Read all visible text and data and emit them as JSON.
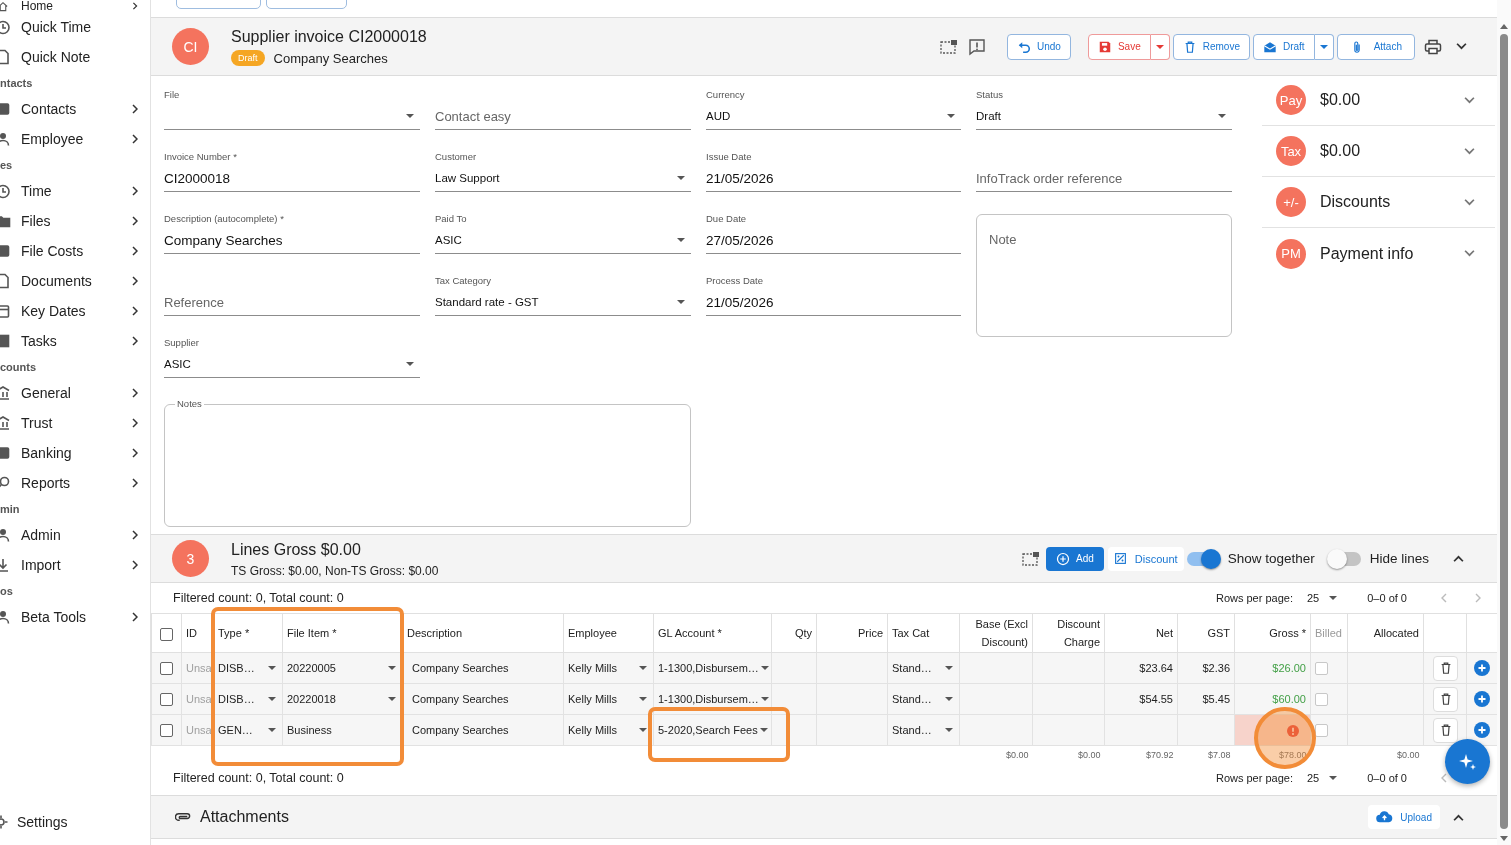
{
  "sidebar": {
    "items": [
      {
        "kind": "item",
        "label": "Home",
        "has_submenu": true
      },
      {
        "kind": "item",
        "label": "Quick Time",
        "has_submenu": false
      },
      {
        "kind": "item",
        "label": "Quick Note",
        "has_submenu": false
      },
      {
        "kind": "section",
        "label": "ntacts"
      },
      {
        "kind": "item",
        "label": "Contacts",
        "has_submenu": true
      },
      {
        "kind": "item",
        "label": "Employee",
        "has_submenu": true
      },
      {
        "kind": "section",
        "label": "es"
      },
      {
        "kind": "item",
        "label": "Time",
        "has_submenu": true
      },
      {
        "kind": "item",
        "label": "Files",
        "has_submenu": true
      },
      {
        "kind": "item",
        "label": "File Costs",
        "has_submenu": true
      },
      {
        "kind": "item",
        "label": "Documents",
        "has_submenu": true
      },
      {
        "kind": "item",
        "label": "Key Dates",
        "has_submenu": true
      },
      {
        "kind": "item",
        "label": "Tasks",
        "has_submenu": true
      },
      {
        "kind": "section",
        "label": "counts"
      },
      {
        "kind": "item",
        "label": "General",
        "has_submenu": true
      },
      {
        "kind": "item",
        "label": "Trust",
        "has_submenu": true
      },
      {
        "kind": "item",
        "label": "Banking",
        "has_submenu": true
      },
      {
        "kind": "item",
        "label": "Reports",
        "has_submenu": true
      },
      {
        "kind": "section",
        "label": "min"
      },
      {
        "kind": "item",
        "label": "Admin",
        "has_submenu": true
      },
      {
        "kind": "item",
        "label": "Import",
        "has_submenu": true
      },
      {
        "kind": "section",
        "label": "os"
      },
      {
        "kind": "item",
        "label": "Beta Tools",
        "has_submenu": true
      }
    ],
    "footer_item": {
      "label": "Settings"
    }
  },
  "header": {
    "avatar": "CI",
    "title": "Supplier invoice CI2000018",
    "status_badge": "Draft",
    "subtitle": "Company Searches",
    "actions": [
      {
        "kind": "undo",
        "label": "Undo",
        "split": false
      },
      {
        "kind": "save",
        "label": "Save",
        "split": true
      },
      {
        "kind": "remove",
        "label": "Remove",
        "split": false
      },
      {
        "kind": "draft",
        "label": "Draft",
        "split": true
      },
      {
        "kind": "attach",
        "label": "Attach",
        "split": false
      }
    ]
  },
  "form": {
    "columns": [
      [
        {
          "kind": "select",
          "label": "File"
        },
        {
          "kind": "text",
          "label": "Invoice Number *",
          "value": "CI2000018"
        },
        {
          "kind": "text",
          "label": "Description (autocomplete) *",
          "value": "Company Searches"
        },
        {
          "kind": "text",
          "placeholder": "Reference"
        },
        {
          "kind": "select",
          "label": "Supplier",
          "value": "ASIC"
        }
      ],
      [
        {
          "kind": "text",
          "placeholder": "Contact easy"
        },
        {
          "kind": "select",
          "label": "Customer",
          "value": "Law Support"
        },
        {
          "kind": "select",
          "label": "Paid To",
          "value": "ASIC"
        },
        {
          "kind": "select",
          "label": "Tax Category",
          "value": "Standard rate - GST"
        }
      ],
      [
        {
          "kind": "select",
          "label": "Currency",
          "value": "AUD"
        },
        {
          "kind": "text",
          "label": "Issue Date",
          "value": "21/05/2026"
        },
        {
          "kind": "text",
          "label": "Due Date",
          "value": "27/05/2026"
        },
        {
          "kind": "text",
          "label": "Process Date",
          "value": "21/05/2026"
        }
      ],
      [
        {
          "kind": "select",
          "label": "Status",
          "value": "Draft"
        },
        {
          "kind": "text",
          "placeholder": "InfoTrack order reference"
        },
        {
          "kind": "textarea",
          "placeholder": "Note"
        }
      ]
    ],
    "notes": {
      "label": "Notes"
    }
  },
  "summary": [
    {
      "badge": "Pay",
      "label": "$0.00",
      "expanded": false
    },
    {
      "badge": "Tax",
      "label": "$0.00",
      "expanded": false
    },
    {
      "badge": "+/-",
      "label": "Discounts",
      "expanded": false
    },
    {
      "badge": "PM",
      "label": "Payment info",
      "expanded": false
    }
  ],
  "lines": {
    "badge": "3",
    "title": "Lines Gross $0.00",
    "subtitle": "TS Gross: $0.00, Non-TS Gross: $0.00",
    "add_label": "Add",
    "discount_label": "Discount",
    "toggles": [
      {
        "label": "Show together",
        "on": true
      },
      {
        "label": "Hide lines",
        "on": false
      }
    ],
    "expanded": true,
    "top_pager": {
      "count": "Filtered count: 0, Total count: 0",
      "rows_per_page_label": "Rows per page:",
      "rows_per_page": "25",
      "range": "0–0 of 0",
      "prev_enabled": false,
      "next_enabled": false
    },
    "table": {
      "columns": [
        {
          "kind": "checkbox",
          "checked": false
        },
        {
          "kind": "text",
          "label": "ID"
        },
        {
          "kind": "text",
          "label": "Type *",
          "highlighted": true
        },
        {
          "kind": "text",
          "label": "File Item *",
          "highlighted": true
        },
        {
          "kind": "text",
          "label": "Description"
        },
        {
          "kind": "text",
          "label": "Employee"
        },
        {
          "kind": "text",
          "label": "GL Account *"
        },
        {
          "kind": "number",
          "label": "Qty"
        },
        {
          "kind": "number",
          "label": "Price"
        },
        {
          "kind": "text",
          "label": "Tax Cat"
        },
        {
          "kind": "number",
          "label": "Base (Excl Discount)"
        },
        {
          "kind": "number",
          "label": "Discount Charge"
        },
        {
          "kind": "number",
          "label": "Net"
        },
        {
          "kind": "number",
          "label": "GST"
        },
        {
          "kind": "number",
          "label": "Gross *"
        },
        {
          "kind": "text",
          "label": "Billed",
          "disabled": true
        },
        {
          "kind": "number",
          "label": "Allocated"
        },
        {
          "kind": "actions"
        },
        {
          "kind": "actions"
        }
      ],
      "rows": [
        {
          "cells": [
            {
              "kind": "checkbox",
              "checked": false
            },
            {
              "kind": "text",
              "text": "Unsa",
              "muted": true
            },
            {
              "kind": "select",
              "text": "DISB…"
            },
            {
              "kind": "select",
              "text": "20220005"
            },
            {
              "kind": "text",
              "text": "Company Searches"
            },
            {
              "kind": "select",
              "text": "Kelly Mills"
            },
            {
              "kind": "select",
              "text": "1-1300,Disbursem…"
            },
            {
              "kind": "empty"
            },
            {
              "kind": "empty"
            },
            {
              "kind": "select",
              "text": "Stand…"
            },
            {
              "kind": "empty"
            },
            {
              "kind": "empty"
            },
            {
              "kind": "number",
              "text": "$23.64"
            },
            {
              "kind": "number",
              "text": "$2.36"
            },
            {
              "kind": "number",
              "text": "$26.00",
              "color": "#43a047"
            },
            {
              "kind": "checkbox",
              "checked": false,
              "disabled": true
            },
            {
              "kind": "empty"
            },
            {
              "kind": "delete"
            },
            {
              "kind": "add"
            }
          ]
        },
        {
          "cells": [
            {
              "kind": "checkbox",
              "checked": false
            },
            {
              "kind": "text",
              "text": "Unsa",
              "muted": true
            },
            {
              "kind": "select",
              "text": "DISB…"
            },
            {
              "kind": "select",
              "text": "20220018"
            },
            {
              "kind": "text",
              "text": "Company Searches"
            },
            {
              "kind": "select",
              "text": "Kelly Mills"
            },
            {
              "kind": "select",
              "text": "1-1300,Disbursem…"
            },
            {
              "kind": "empty"
            },
            {
              "kind": "empty"
            },
            {
              "kind": "select",
              "text": "Stand…"
            },
            {
              "kind": "empty"
            },
            {
              "kind": "empty"
            },
            {
              "kind": "number",
              "text": "$54.55"
            },
            {
              "kind": "number",
              "text": "$5.45"
            },
            {
              "kind": "number",
              "text": "$60.00",
              "color": "#43a047"
            },
            {
              "kind": "checkbox",
              "checked": false,
              "disabled": true
            },
            {
              "kind": "empty"
            },
            {
              "kind": "delete"
            },
            {
              "kind": "add"
            }
          ]
        },
        {
          "cells": [
            {
              "kind": "checkbox",
              "checked": false
            },
            {
              "kind": "text",
              "text": "Unsa",
              "muted": true
            },
            {
              "kind": "select",
              "text": "GEN…"
            },
            {
              "kind": "text",
              "text": "Business"
            },
            {
              "kind": "text",
              "text": "Company Searches"
            },
            {
              "kind": "select",
              "text": "Kelly Mills"
            },
            {
              "kind": "select",
              "text": "5-2020,Search Fees",
              "highlighted": true
            },
            {
              "kind": "empty"
            },
            {
              "kind": "empty"
            },
            {
              "kind": "select",
              "text": "Stand…"
            },
            {
              "kind": "empty"
            },
            {
              "kind": "empty"
            },
            {
              "kind": "empty"
            },
            {
              "kind": "empty"
            },
            {
              "kind": "error",
              "circled": true
            },
            {
              "kind": "checkbox",
              "checked": false,
              "disabled": true
            },
            {
              "kind": "empty"
            },
            {
              "kind": "delete"
            },
            {
              "kind": "add"
            }
          ]
        }
      ],
      "totals": [
        {
          "kind": "empty"
        },
        {
          "kind": "empty"
        },
        {
          "kind": "empty"
        },
        {
          "kind": "empty"
        },
        {
          "kind": "empty"
        },
        {
          "kind": "empty"
        },
        {
          "kind": "empty"
        },
        {
          "kind": "empty"
        },
        {
          "kind": "empty"
        },
        {
          "kind": "empty"
        },
        {
          "kind": "number",
          "text": "$0.00"
        },
        {
          "kind": "number",
          "text": "$0.00"
        },
        {
          "kind": "number",
          "text": "$70.92"
        },
        {
          "kind": "number",
          "text": "$7.08"
        },
        {
          "kind": "number",
          "text": "$78.00"
        },
        {
          "kind": "empty"
        },
        {
          "kind": "number",
          "text": "$0.00"
        },
        {
          "kind": "empty"
        },
        {
          "kind": "empty"
        }
      ]
    },
    "bottom_pager": {
      "count": "Filtered count: 0, Total count: 0",
      "rows_per_page_label": "Rows per page:",
      "rows_per_page": "25",
      "range": "0–0 of 0",
      "prev_enabled": false
    }
  },
  "attachments": {
    "title": "Attachments",
    "upload_label": "Upload",
    "expanded": true
  }
}
